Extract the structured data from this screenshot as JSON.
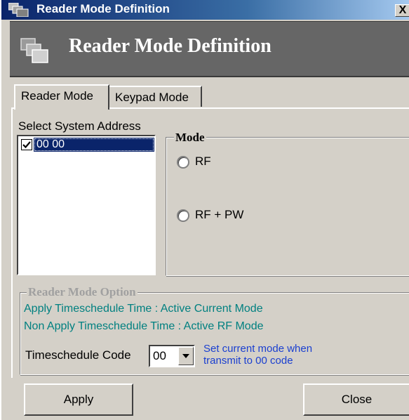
{
  "window": {
    "title": "Reader Mode Definition",
    "close_glyph": "X"
  },
  "banner": {
    "title": "Reader Mode Definition",
    "icon": "stacked-windows-icon"
  },
  "tabs": [
    {
      "label": "Reader Mode",
      "selected": true
    },
    {
      "label": "Keypad Mode",
      "selected": false
    }
  ],
  "system_address": {
    "label": "Select System Address",
    "items": [
      {
        "text": "00 00",
        "checked": true,
        "selected": true
      }
    ]
  },
  "mode": {
    "legend": "Mode",
    "options": [
      {
        "label": "RF",
        "selected": false
      },
      {
        "label": "RF + PW",
        "selected": false
      }
    ]
  },
  "reader_mode_option": {
    "legend": "Reader Mode Option",
    "apply_timeschedule": "Apply Timeschedule  Time : Active Current Mode",
    "non_apply_timeschedule": "Non Apply Timeschedule Time : Active RF Mode",
    "timeschedule_code_label": "Timeschedule Code",
    "timeschedule_code_value": "00",
    "hint_line1": "Set current mode when",
    "hint_line2": "transmit to 00 code"
  },
  "buttons": {
    "apply": "Apply",
    "close": "Close"
  },
  "colors": {
    "title_bar": "#0a246a",
    "face": "#d4d0c8",
    "banner": "#666666",
    "teal_text": "#008080",
    "hint_text": "#1a3fd0",
    "selection": "#0a246a"
  }
}
